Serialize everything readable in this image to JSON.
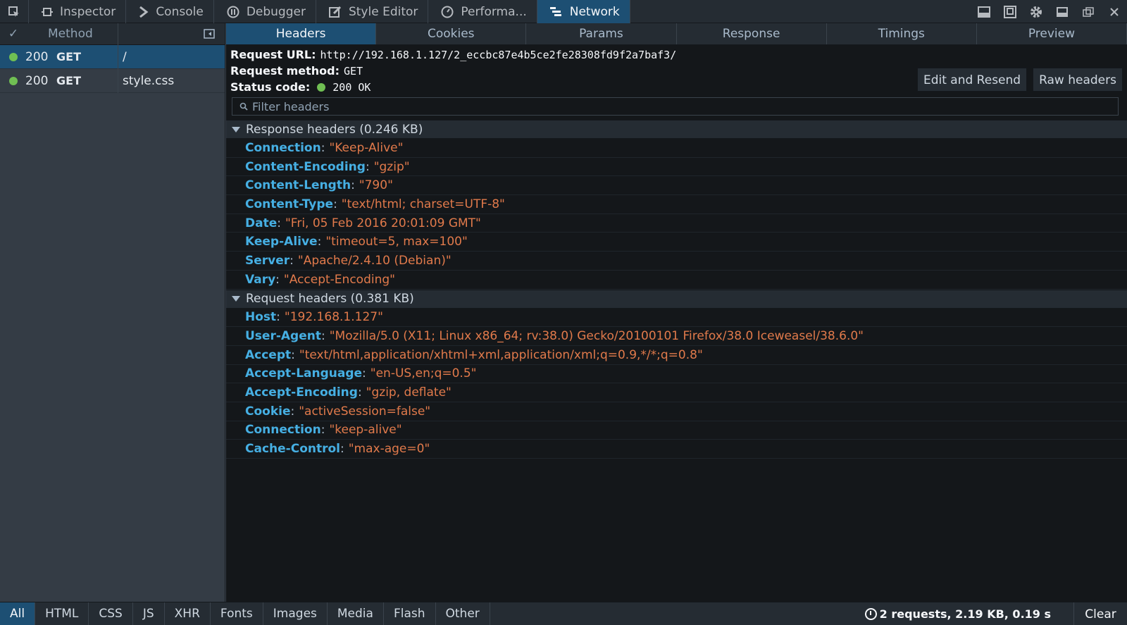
{
  "toolbar": {
    "tabs": [
      {
        "label": "Inspector",
        "icon": "inspector-icon"
      },
      {
        "label": "Console",
        "icon": "console-icon"
      },
      {
        "label": "Debugger",
        "icon": "debugger-icon"
      },
      {
        "label": "Style Editor",
        "icon": "style-editor-icon"
      },
      {
        "label": "Performa...",
        "icon": "performance-icon"
      },
      {
        "label": "Network",
        "icon": "network-icon",
        "active": true
      }
    ],
    "right_icons": [
      "split-console-icon",
      "responsive-design-icon",
      "settings-icon",
      "dock-side-icon",
      "undock-icon",
      "close-icon"
    ]
  },
  "request_list": {
    "header_method": "Method",
    "check_mark": "✓",
    "rows": [
      {
        "status": "200",
        "method": "GET",
        "file": "/",
        "selected": true
      },
      {
        "status": "200",
        "method": "GET",
        "file": "style.css",
        "selected": false
      }
    ]
  },
  "details": {
    "tabs": [
      "Headers",
      "Cookies",
      "Params",
      "Response",
      "Timings",
      "Preview"
    ],
    "active_tab": "Headers",
    "request_url_label": "Request URL:",
    "request_url": "http://192.168.1.127/2_eccbc87e4b5ce2fe28308fd9f2a7baf3/",
    "request_method_label": "Request method:",
    "request_method": "GET",
    "status_code_label": "Status code:",
    "status_code": "200 OK",
    "edit_resend": "Edit and Resend",
    "raw_headers": "Raw headers",
    "filter_placeholder": "Filter headers",
    "response_section": "Response headers (0.246 KB)",
    "response_headers": [
      {
        "name": "Connection",
        "value": "\"Keep-Alive\""
      },
      {
        "name": "Content-Encoding",
        "value": "\"gzip\""
      },
      {
        "name": "Content-Length",
        "value": "\"790\""
      },
      {
        "name": "Content-Type",
        "value": "\"text/html; charset=UTF-8\""
      },
      {
        "name": "Date",
        "value": "\"Fri, 05 Feb 2016 20:01:09 GMT\""
      },
      {
        "name": "Keep-Alive",
        "value": "\"timeout=5, max=100\""
      },
      {
        "name": "Server",
        "value": "\"Apache/2.4.10 (Debian)\""
      },
      {
        "name": "Vary",
        "value": "\"Accept-Encoding\""
      }
    ],
    "request_section": "Request headers (0.381 KB)",
    "request_headers": [
      {
        "name": "Host",
        "value": "\"192.168.1.127\""
      },
      {
        "name": "User-Agent",
        "value": "\"Mozilla/5.0 (X11; Linux x86_64; rv:38.0) Gecko/20100101 Firefox/38.0 Iceweasel/38.6.0\""
      },
      {
        "name": "Accept",
        "value": "\"text/html,application/xhtml+xml,application/xml;q=0.9,*/*;q=0.8\""
      },
      {
        "name": "Accept-Language",
        "value": "\"en-US,en;q=0.5\""
      },
      {
        "name": "Accept-Encoding",
        "value": "\"gzip, deflate\""
      },
      {
        "name": "Cookie",
        "value": "\"activeSession=false\""
      },
      {
        "name": "Connection",
        "value": "\"keep-alive\""
      },
      {
        "name": "Cache-Control",
        "value": "\"max-age=0\""
      }
    ]
  },
  "filters": [
    "All",
    "HTML",
    "CSS",
    "JS",
    "XHR",
    "Fonts",
    "Images",
    "Media",
    "Flash",
    "Other"
  ],
  "active_filter": "All",
  "summary": "2 requests, 2.19 KB, 0.19 s",
  "clear_label": "Clear",
  "colors": {
    "accent": "#1d4f73",
    "header_name": "#46afe3",
    "header_value": "#e17a4b",
    "status_ok": "#70bf53"
  }
}
